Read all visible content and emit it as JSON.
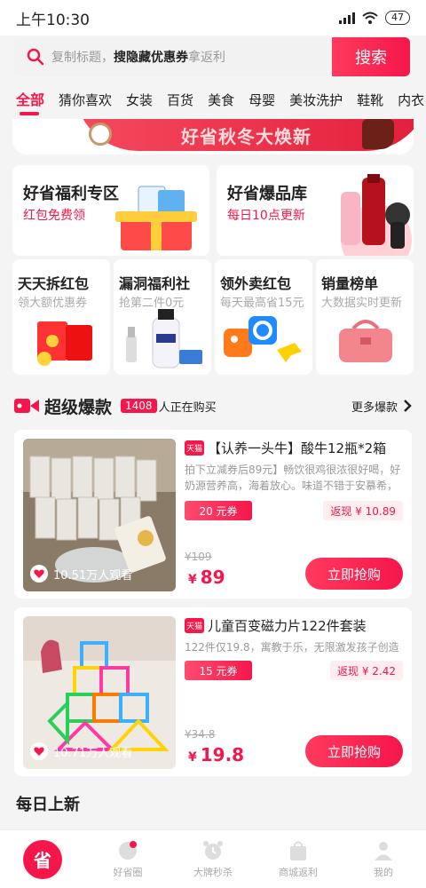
{
  "status": {
    "time": "上午10:30",
    "battery": "47"
  },
  "search": {
    "hint_pre": "复制标题，",
    "hint_bold": "搜隐藏优惠券",
    "hint_post": "拿返利",
    "button": "搜索"
  },
  "tabs": [
    "全部",
    "猜你喜欢",
    "女装",
    "百货",
    "美食",
    "母婴",
    "美妆洗护",
    "鞋靴",
    "内衣"
  ],
  "banner": {
    "text": "好省秋冬大焕新"
  },
  "big_cards": [
    {
      "title": "好省福利专区",
      "sub": "红包免费领"
    },
    {
      "title": "好省爆品库",
      "sub": "每日10点更新"
    }
  ],
  "small_cards": [
    {
      "title": "天天拆红包",
      "sub": "领大额优惠券"
    },
    {
      "title": "漏洞福利社",
      "sub": "抢第二件0元"
    },
    {
      "title": "领外卖红包",
      "sub": "每天最高省15元"
    },
    {
      "title": "销量榜单",
      "sub": "大数据实时更新"
    }
  ],
  "hot": {
    "title": "超级爆款",
    "count": "1408",
    "count_text": "人正在购买",
    "more": "更多爆款"
  },
  "products": [
    {
      "shop_tag": "天猫",
      "title": "【认养一头牛】酸牛12瓶*2箱",
      "desc": "拍下立减券后89元】畅饮很鸡很浓很好喝，好奶源营养高，海着放心。味道不错于安慕希，健的...",
      "coupon": "20 元券",
      "cashback": "返现 ¥ 10.89",
      "orig_price": "¥109",
      "price_symbol": "¥",
      "price": "89",
      "views": "10.51万人观看",
      "buy": "立即抢购"
    },
    {
      "shop_tag": "天猫",
      "title": "儿童百变磁力片122件套装",
      "desc": "122件仅19.8，寓教于乐，无限激发孩子创造力",
      "coupon": "15 元券",
      "cashback": "返现 ¥ 2.42",
      "orig_price": "¥34.8",
      "price_symbol": "¥",
      "price": "19.8",
      "views": "10.71万人观看",
      "buy": "立即抢购"
    }
  ],
  "daily": "每日上新",
  "nav": [
    {
      "label": "",
      "icon": "home-logo-icon"
    },
    {
      "label": "好省圈",
      "icon": "circle-icon"
    },
    {
      "label": "大牌秒杀",
      "icon": "alarm-icon"
    },
    {
      "label": "商城返利",
      "icon": "bag-icon"
    },
    {
      "label": "我的",
      "icon": "user-icon"
    }
  ],
  "nav_home_glyph": "省"
}
